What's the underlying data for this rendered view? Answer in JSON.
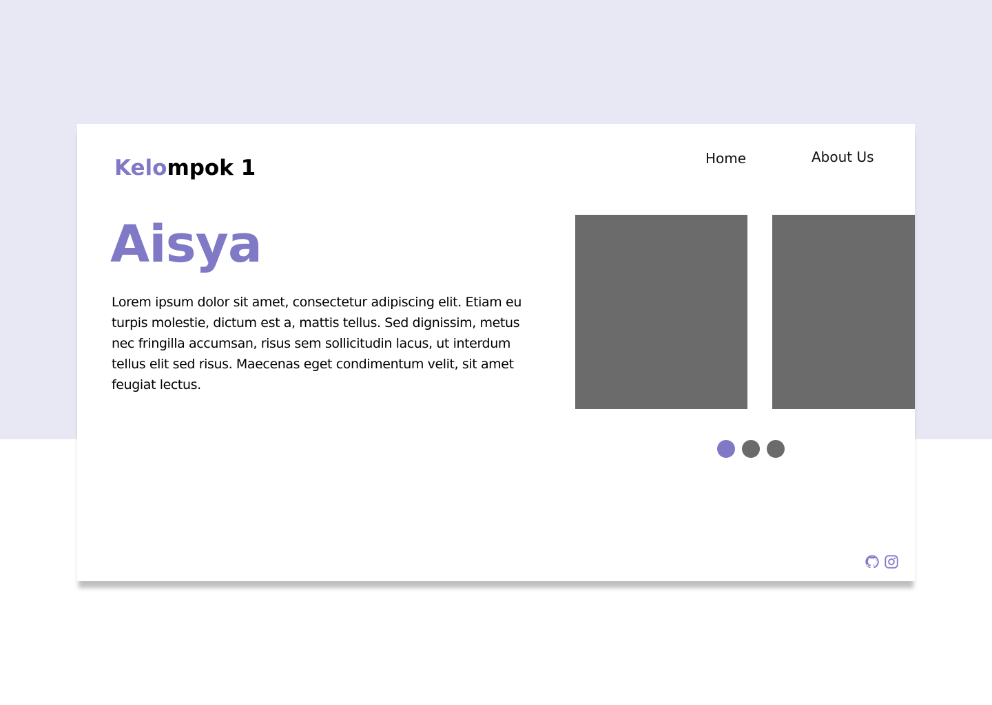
{
  "logo": {
    "accent": "Kelo",
    "rest": "mpok 1"
  },
  "nav": {
    "home": "Home",
    "about": "About Us"
  },
  "hero": {
    "title": "Aisya",
    "text": "Lorem ipsum dolor sit amet, consectetur adipiscing elit. Etiam eu turpis molestie, dictum est a, mattis tellus. Sed dignissim, metus nec fringilla accumsan, risus sem sollicitudin lacus, ut interdum tellus elit sed risus. Maecenas eget condimentum velit, sit amet feugiat lectus."
  },
  "carousel": {
    "slide_count": 3,
    "active_index": 0
  },
  "social": {
    "icons": [
      "github-icon",
      "instagram-icon"
    ]
  },
  "colors": {
    "accent": "#8079c6",
    "background": "#e8e8f4",
    "placeholder": "#6b6b6b"
  }
}
